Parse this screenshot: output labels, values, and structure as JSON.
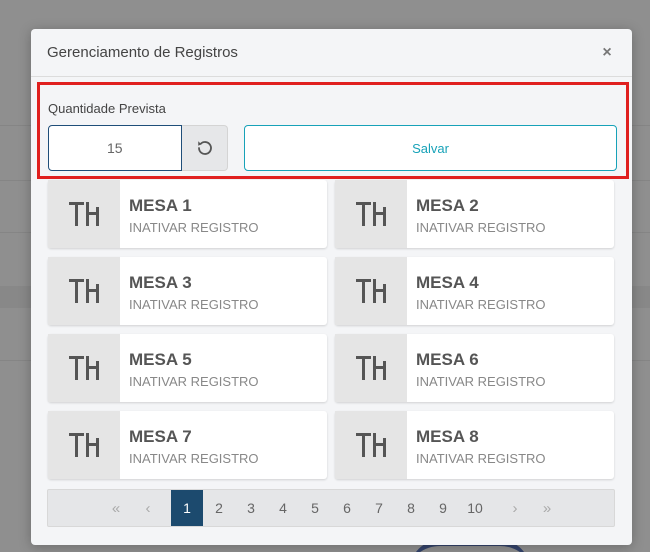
{
  "modal": {
    "title": "Gerenciamento de Registros",
    "close_label": "×"
  },
  "quantity": {
    "label": "Quantidade Prevista",
    "value": "15",
    "save_label": "Salvar"
  },
  "cards": [
    {
      "title": "MESA 1",
      "subtitle": "INATIVAR REGISTRO"
    },
    {
      "title": "MESA 2",
      "subtitle": "INATIVAR REGISTRO"
    },
    {
      "title": "MESA 3",
      "subtitle": "INATIVAR REGISTRO"
    },
    {
      "title": "MESA 4",
      "subtitle": "INATIVAR REGISTRO"
    },
    {
      "title": "MESA 5",
      "subtitle": "INATIVAR REGISTRO"
    },
    {
      "title": "MESA 6",
      "subtitle": "INATIVAR REGISTRO"
    },
    {
      "title": "MESA 7",
      "subtitle": "INATIVAR REGISTRO"
    },
    {
      "title": "MESA 8",
      "subtitle": "INATIVAR REGISTRO"
    }
  ],
  "pagination": {
    "first": "«",
    "prev": "‹",
    "pages": [
      "1",
      "2",
      "3",
      "4",
      "5",
      "6",
      "7",
      "8",
      "9",
      "10"
    ],
    "active_page": "1",
    "next": "›",
    "last": "»"
  },
  "icons": {
    "card": "table-chairs-icon",
    "reset": "reset-icon",
    "close": "close-icon"
  },
  "colors": {
    "highlight_border": "#e0201f",
    "accent": "#17a2b8",
    "active_page": "#1c4a6e"
  }
}
